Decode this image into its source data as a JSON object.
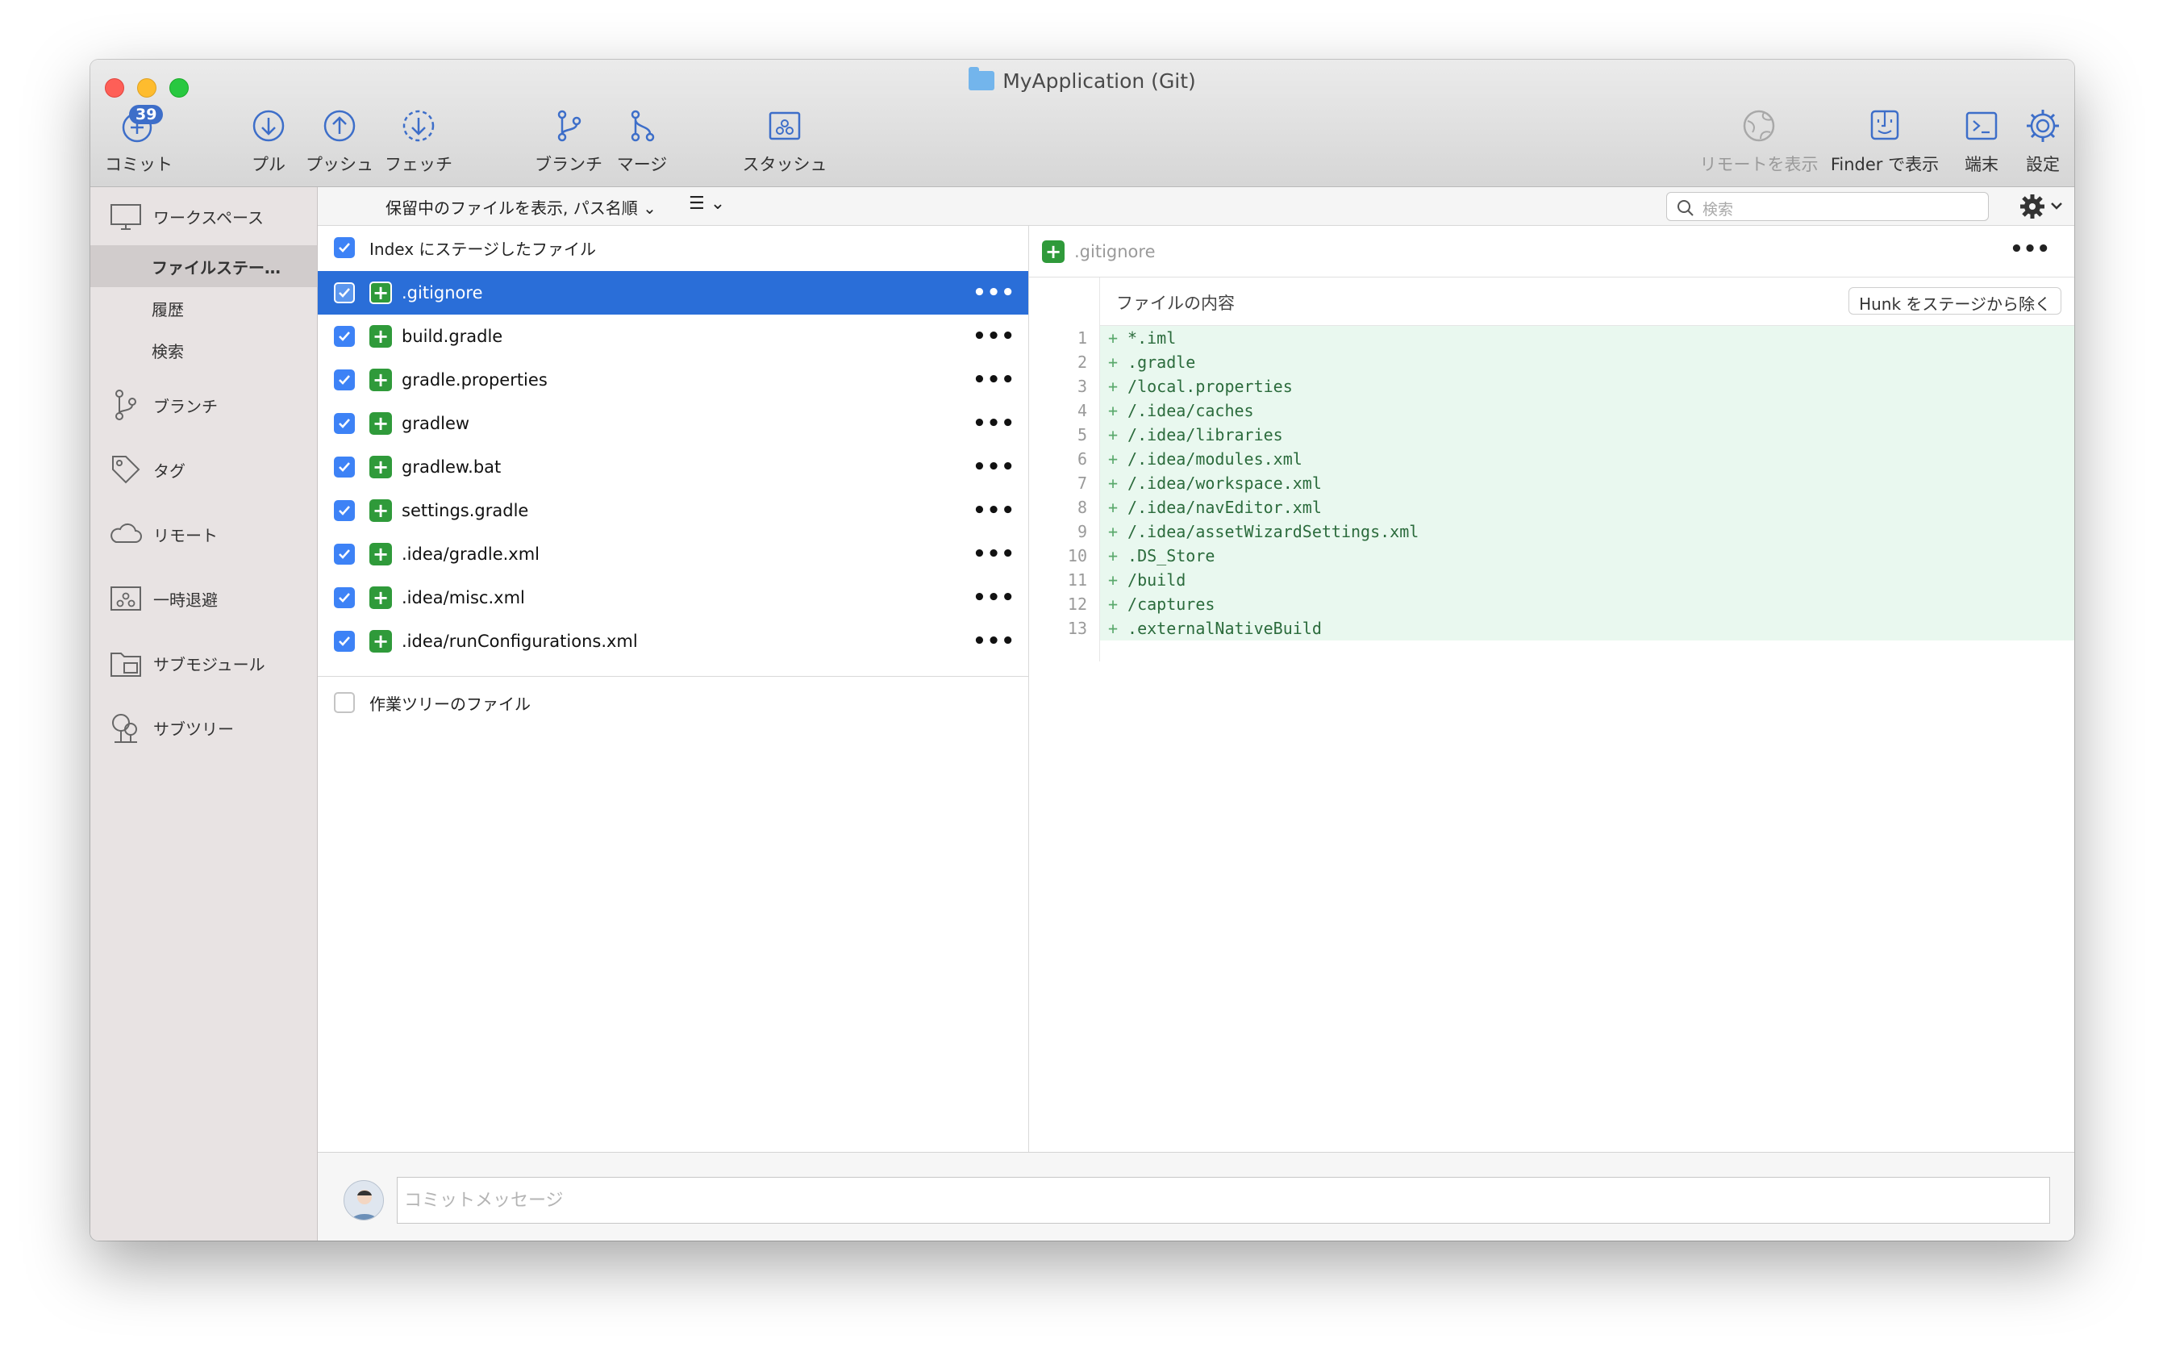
{
  "window": {
    "title": "MyApplication (Git)"
  },
  "toolbar": {
    "commit": {
      "label": "コミット",
      "badge": "39"
    },
    "pull": "プル",
    "push": "プッシュ",
    "fetch": "フェッチ",
    "branch": "ブランチ",
    "merge": "マージ",
    "stash": "スタッシュ",
    "show_remote": "リモートを表示",
    "show_finder": "Finder で表示",
    "terminal": "端末",
    "settings": "設定"
  },
  "sidebar": {
    "workspace": "ワークスペース",
    "file_status": "ファイルステー…",
    "history": "履歴",
    "search": "検索",
    "branches": "ブランチ",
    "tags": "タグ",
    "remotes": "リモート",
    "stashes": "一時退避",
    "submodules": "サブモジュール",
    "subtrees": "サブツリー"
  },
  "filterbar": {
    "filter": "保留中のファイルを表示, パス名順",
    "search_placeholder": "検索"
  },
  "staged": {
    "header": "Index にステージしたファイル",
    "files": [
      ".gitignore",
      "build.gradle",
      "gradle.properties",
      "gradlew",
      "gradlew.bat",
      "settings.gradle",
      ".idea/gradle.xml",
      ".idea/misc.xml",
      ".idea/runConfigurations.xml"
    ]
  },
  "unstaged": {
    "header": "作業ツリーのファイル"
  },
  "diff": {
    "filename": ".gitignore",
    "hunk_title": "ファイルの内容",
    "hunk_button": "Hunk をステージから除く",
    "lines": [
      {
        "n": "1",
        "text": "*.iml"
      },
      {
        "n": "2",
        "text": ".gradle"
      },
      {
        "n": "3",
        "text": "/local.properties"
      },
      {
        "n": "4",
        "text": "/.idea/caches"
      },
      {
        "n": "5",
        "text": "/.idea/libraries"
      },
      {
        "n": "6",
        "text": "/.idea/modules.xml"
      },
      {
        "n": "7",
        "text": "/.idea/workspace.xml"
      },
      {
        "n": "8",
        "text": "/.idea/navEditor.xml"
      },
      {
        "n": "9",
        "text": "/.idea/assetWizardSettings.xml"
      },
      {
        "n": "10",
        "text": ".DS_Store"
      },
      {
        "n": "11",
        "text": "/build"
      },
      {
        "n": "12",
        "text": "/captures"
      },
      {
        "n": "13",
        "text": ".externalNativeBuild"
      }
    ]
  },
  "commit": {
    "placeholder": "コミットメッセージ"
  },
  "colors": {
    "accent": "#2a6ed8",
    "added": "#2f9a3a",
    "added_bg": "#e9f8ef"
  }
}
